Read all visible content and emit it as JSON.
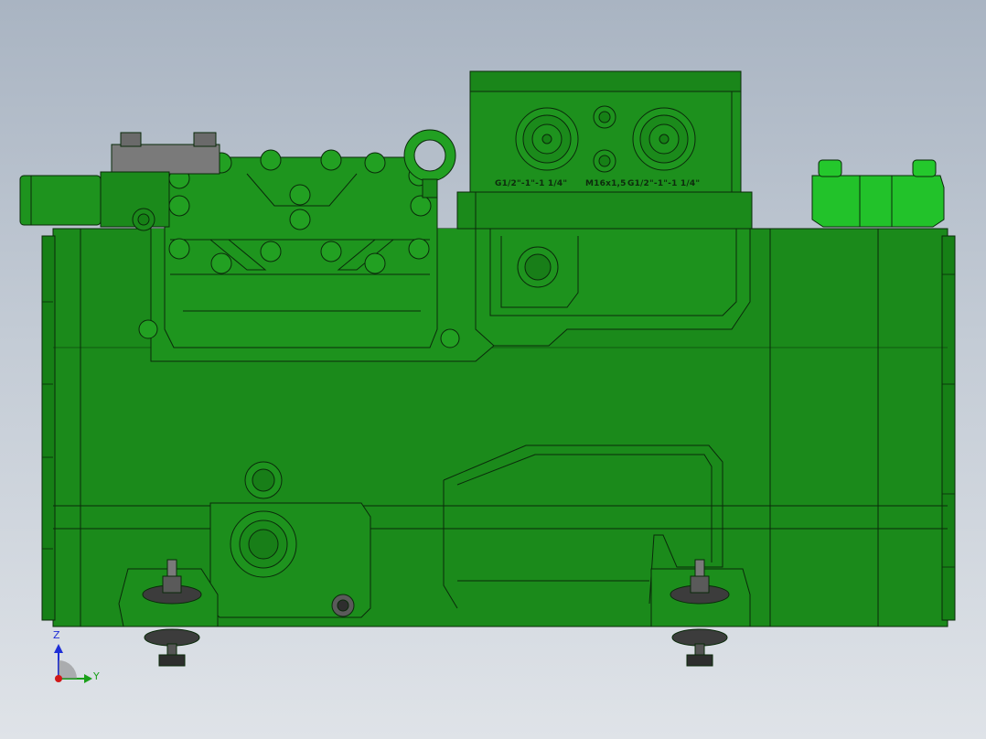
{
  "model": {
    "port_labels": {
      "left": "G1/2\"-1\"-1  1/4\"",
      "center": "M16x1,5",
      "right": "G1/2\"-1\"-1  1/4\""
    },
    "colors": {
      "body": "#1b8a1b",
      "body_dark": "#0f6a0f",
      "body_light": "#2fa82f",
      "edge": "#0a2a0a",
      "bright_cap": "#22c22a",
      "grey_block": "#7a7a7a",
      "grey_dark": "#3c3c3c"
    }
  },
  "triad": {
    "z_label": "Z",
    "y_label": "Y",
    "colors": {
      "z": "#1f2fd6",
      "y": "#1aa01a",
      "x": "#d01818"
    }
  }
}
